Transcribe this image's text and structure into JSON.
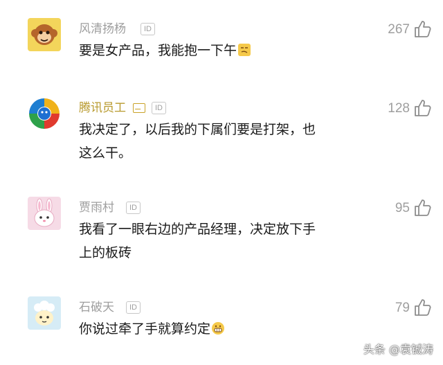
{
  "comments": [
    {
      "username": "风清扬杨",
      "id_badge": "ID",
      "likes": "267",
      "text_lines": [
        "要是女产品，我能抱一下午"
      ],
      "emoji": "smug-face-emoji",
      "avatar": "monkey-avatar"
    },
    {
      "username": "腾讯员工",
      "id_badge": "ID",
      "likes": "128",
      "verified_icon": "vip-card-icon",
      "text_lines": [
        "我决定了，以后我的下属们要是打架，也",
        "这么干。"
      ],
      "avatar": "tencent-news-avatar"
    },
    {
      "username": "贾雨村",
      "id_badge": "ID",
      "likes": "95",
      "text_lines": [
        "我看了一眼右边的产品经理，决定放下手",
        "上的板砖"
      ],
      "avatar": "bunny-avatar"
    },
    {
      "username": "石破天",
      "id_badge": "ID",
      "likes": "79",
      "text_lines": [
        "你说过牵了手就算约定"
      ],
      "emoji": "grimace-face-emoji",
      "avatar": "sheep-avatar"
    }
  ],
  "watermark": "头条 @袁铖涛",
  "like_icon": "thumbs-up-icon",
  "colors": {
    "username": "#9e9e9e",
    "verified_username": "#b89a2e",
    "text": "#1a1a1a",
    "avatar_monkey_bg": "#f3d55b",
    "avatar_bunny_bg": "#f6dbe6",
    "avatar_sheep_bg": "#d6ecf6"
  }
}
